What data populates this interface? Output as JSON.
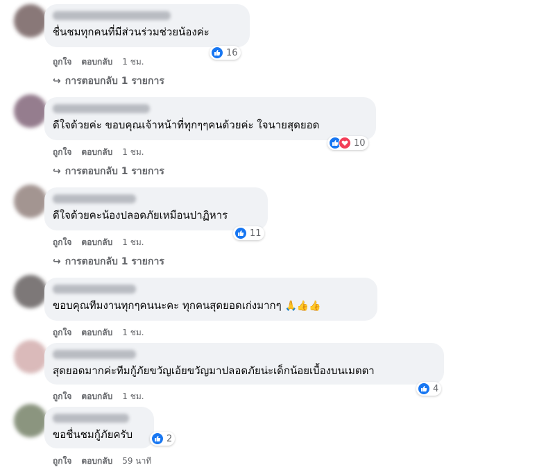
{
  "comments": [
    {
      "text": "ชื่นชมทุกคนที่มีส่วนร่วมช่วยน้องค่ะ",
      "reactions": {
        "types": [
          "like"
        ],
        "count": "16"
      },
      "actions": {
        "like": "ถูกใจ",
        "reply": "ตอบกลับ",
        "time": "1 ชม."
      },
      "replies": "การตอบกลับ 1 รายการ",
      "avatar_color": "#7d6a6a"
    },
    {
      "text": "ดีใจด้วยค่ะ ขอบคุณเจ้าหน้าที่ทุกๆๆคนด้วยค่ะ ใจนายสุดยอด",
      "reactions": {
        "types": [
          "like",
          "love"
        ],
        "count": "10"
      },
      "actions": {
        "like": "ถูกใจ",
        "reply": "ตอบกลับ",
        "time": "1 ชม."
      },
      "replies": "การตอบกลับ 1 รายการ",
      "avatar_color": "#8a6f82"
    },
    {
      "text": "ดีใจด้วยคะน้องปลอดภัยเหมือนปาฏิหาร",
      "reactions": {
        "types": [
          "like"
        ],
        "count": "11"
      },
      "actions": {
        "like": "ถูกใจ",
        "reply": "ตอบกลับ",
        "time": "1 ชม."
      },
      "replies": "การตอบกลับ 1 รายการ",
      "avatar_color": "#9a8a86"
    },
    {
      "text": "ขอบคุณทีมงานทุกๆคนนะคะ ทุกคนสุดยอดเก่งมากๆ",
      "emojis": [
        "🙏",
        "👍",
        "👍"
      ],
      "actions": {
        "like": "ถูกใจ",
        "reply": "ตอบกลับ",
        "time": "1 ชม."
      },
      "avatar_color": "#6f6a6a"
    },
    {
      "text": "สุดยอดมากค่ะทีมกู้ภัยขวัญเอ้ยขวัญมาปลอดภัยน่ะเด็กน้อยเบื้องบนเมตตา",
      "reactions": {
        "types": [
          "like"
        ],
        "count": "4"
      },
      "actions": {
        "like": "ถูกใจ",
        "reply": "ตอบกลับ",
        "time": "1 ชม."
      },
      "avatar_color": "#d6b3b3"
    },
    {
      "text": "ขอชื่นชมกู้ภัยครับ",
      "reactions": {
        "types": [
          "like"
        ],
        "count": "2"
      },
      "actions": {
        "like": "ถูกใจ",
        "reply": "ตอบกลับ",
        "time": "59 นาที"
      },
      "avatar_color": "#7f8a72"
    }
  ],
  "colors": {
    "bubble": "#f0f2f5",
    "meta_text": "#65676b",
    "like_blue": "#1877f2",
    "love_red": "#f33e58"
  }
}
